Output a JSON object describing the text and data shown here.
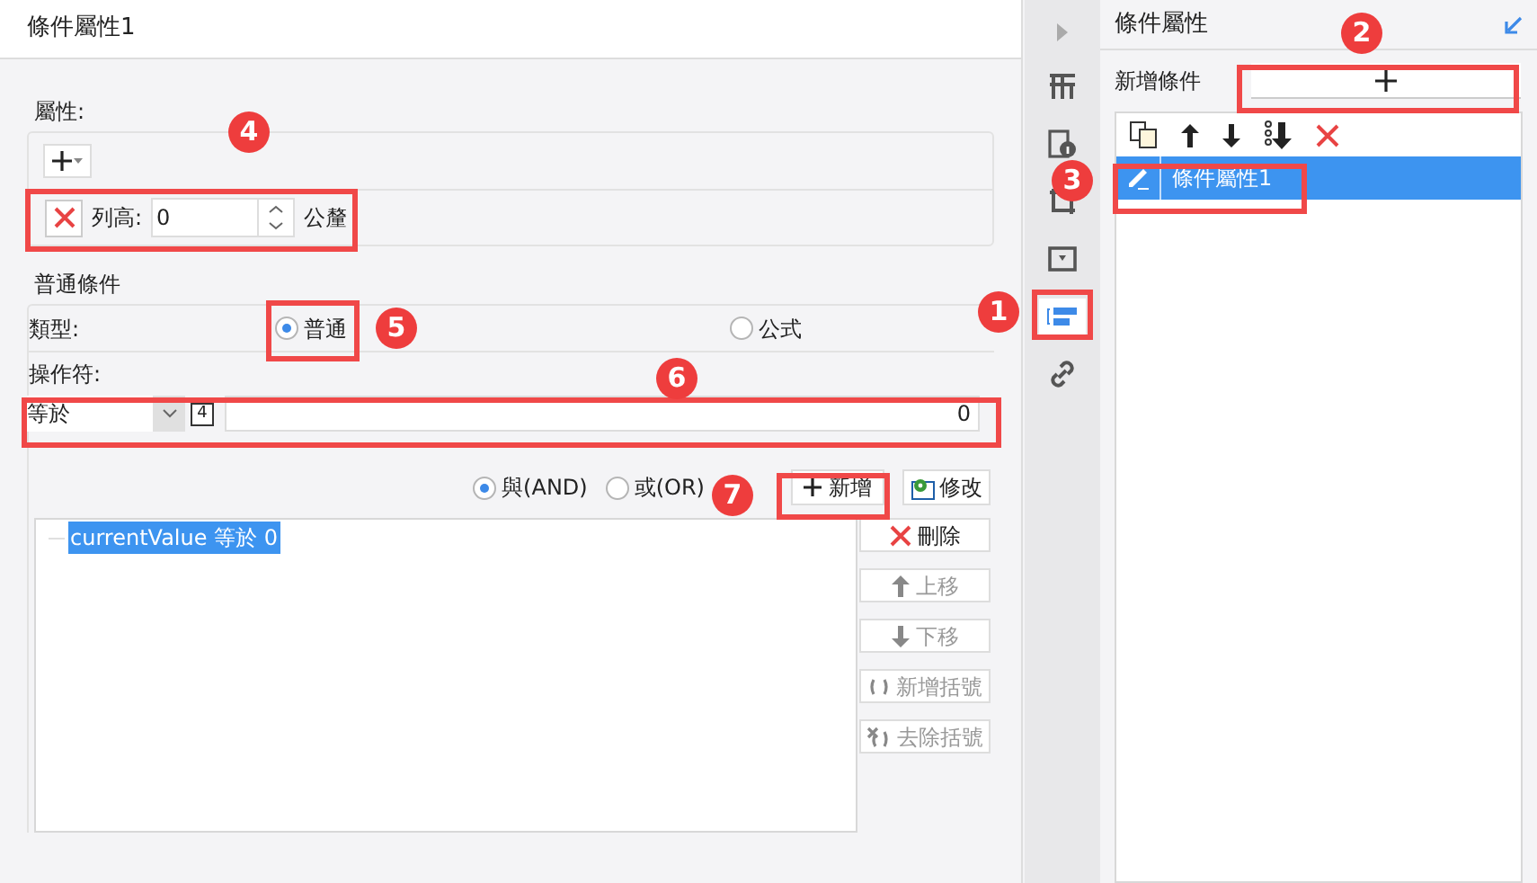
{
  "left_panel": {
    "title": "條件屬性1",
    "properties": {
      "legend": "屬性:",
      "rows": [
        {
          "label": "列高:",
          "value": "0",
          "unit": "公釐"
        }
      ]
    },
    "normal_condition": {
      "legend": "普通條件",
      "type_label": "類型:",
      "types": [
        {
          "label": "普通",
          "selected": true
        },
        {
          "label": "公式",
          "selected": false
        }
      ],
      "operator_label": "操作符:",
      "operator": "等於",
      "format_glyph": "4",
      "value": "0",
      "joins": [
        {
          "label": "與(AND)",
          "selected": true
        },
        {
          "label": "或(OR)",
          "selected": false
        }
      ],
      "add_button": "新增",
      "modify_button": "修改",
      "conditions": [
        {
          "text": "currentValue 等於 0",
          "selected": true
        }
      ],
      "actions": [
        {
          "kind": "delete",
          "label": "刪除",
          "disabled": false
        },
        {
          "kind": "up",
          "label": "上移",
          "disabled": true
        },
        {
          "kind": "down",
          "label": "下移",
          "disabled": true
        },
        {
          "kind": "add-bracket",
          "label": "新增括號",
          "disabled": true
        },
        {
          "kind": "remove-bracket",
          "label": "去除括號",
          "disabled": true
        }
      ]
    }
  },
  "side_tabs": [
    {
      "kind": "expand",
      "selected": false
    },
    {
      "kind": "grid",
      "selected": false
    },
    {
      "kind": "info",
      "selected": false
    },
    {
      "kind": "shape",
      "selected": false
    },
    {
      "kind": "dropdown",
      "selected": false
    },
    {
      "kind": "condition",
      "selected": true
    },
    {
      "kind": "link",
      "selected": false
    }
  ],
  "right_panel": {
    "title": "條件屬性",
    "add_label": "新增條件",
    "items": [
      {
        "label": "條件屬性1",
        "selected": true
      }
    ]
  },
  "callouts": [
    {
      "number": "1"
    },
    {
      "number": "2"
    },
    {
      "number": "3"
    },
    {
      "number": "4"
    },
    {
      "number": "5"
    },
    {
      "number": "6"
    },
    {
      "number": "7"
    }
  ]
}
